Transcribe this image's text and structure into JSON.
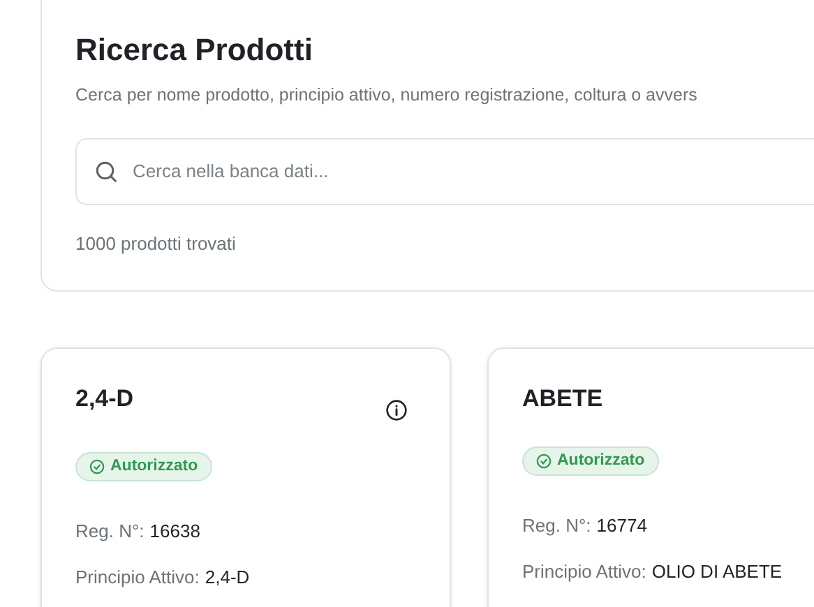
{
  "search_panel": {
    "title": "Ricerca Prodotti",
    "description": "Cerca per nome prodotto, principio attivo, numero registrazione, coltura o avvers",
    "search": {
      "placeholder": "Cerca nella banca dati..."
    },
    "result_count": "1000 prodotti trovati"
  },
  "products": [
    {
      "name": "2,4-D",
      "info_icon": true,
      "status": {
        "label": "Autorizzato",
        "kind": "authorized"
      },
      "reg_label": "Reg. N°:",
      "reg_number": "16638",
      "active_label": "Principio Attivo:",
      "active_ingredient": "2,4-D"
    },
    {
      "name": "ABETE",
      "info_icon": false,
      "status": {
        "label": "Autorizzato",
        "kind": "authorized"
      },
      "reg_label": "Reg. N°:",
      "reg_number": "16774",
      "active_label": "Principio Attivo:",
      "active_ingredient": "OLIO DI ABETE"
    }
  ]
}
